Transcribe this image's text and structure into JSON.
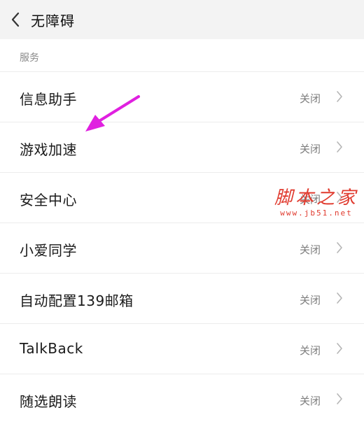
{
  "header": {
    "title": "无障碍",
    "back_icon": "chevron-left-icon"
  },
  "section": {
    "label": "服务"
  },
  "items": [
    {
      "label": "信息助手",
      "value": "关闭"
    },
    {
      "label": "游戏加速",
      "value": "关闭"
    },
    {
      "label": "安全中心",
      "value": "关闭"
    },
    {
      "label": "小爱同学",
      "value": "关闭"
    },
    {
      "label": "自动配置139邮箱",
      "value": "关闭"
    },
    {
      "label": "TalkBack",
      "value": "关闭"
    },
    {
      "label": "随选朗读",
      "value": "关闭"
    }
  ],
  "annotation": {
    "arrow_color": "#e020e0"
  },
  "watermark": {
    "main": "脚本之家",
    "sub": "www.jb51.net",
    "color": "#e03a2e"
  }
}
